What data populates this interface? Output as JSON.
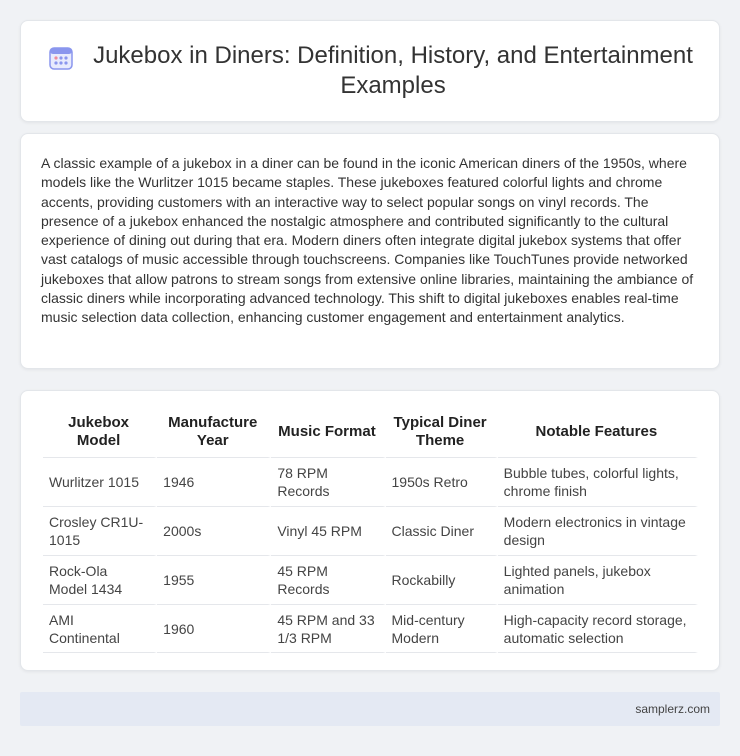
{
  "header": {
    "title": "Jukebox in Diners: Definition, History, and Entertainment Examples",
    "icon": "calendar-grid-icon",
    "icon_color": "#7b8cf0"
  },
  "description": {
    "text": "A classic example of a jukebox in a diner can be found in the iconic American diners of the 1950s, where models like the Wurlitzer 1015 became staples. These jukeboxes featured colorful lights and chrome accents, providing customers with an interactive way to select popular songs on vinyl records. The presence of a jukebox enhanced the nostalgic atmosphere and contributed significantly to the cultural experience of dining out during that era. Modern diners often integrate digital jukebox systems that offer vast catalogs of music accessible through touchscreens. Companies like TouchTunes provide networked jukeboxes that allow patrons to stream songs from extensive online libraries, maintaining the ambiance of classic diners while incorporating advanced technology. This shift to digital jukeboxes enables real-time music selection data collection, enhancing customer engagement and entertainment analytics."
  },
  "table": {
    "headers": [
      "Jukebox Model",
      "Manufacture Year",
      "Music Format",
      "Typical Diner Theme",
      "Notable Features"
    ],
    "rows": [
      [
        "Wurlitzer 1015",
        "1946",
        "78 RPM Records",
        "1950s Retro",
        "Bubble tubes, colorful lights, chrome finish"
      ],
      [
        "Crosley CR1U-1015",
        "2000s",
        "Vinyl 45 RPM",
        "Classic Diner",
        "Modern electronics in vintage design"
      ],
      [
        "Rock-Ola Model 1434",
        "1955",
        "45 RPM Records",
        "Rockabilly",
        "Lighted panels, jukebox animation"
      ],
      [
        "AMI Continental",
        "1960",
        "45 RPM and 33 1/3 RPM",
        "Mid-century Modern",
        "High-capacity record storage, automatic selection"
      ]
    ]
  },
  "footer": {
    "link": "samplerz.com"
  }
}
